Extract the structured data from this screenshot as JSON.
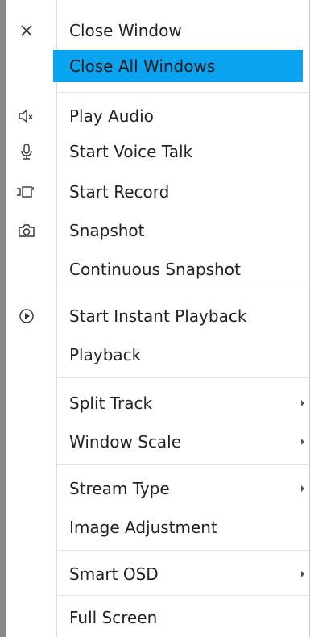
{
  "menu": {
    "items": [
      {
        "label": "Close Window",
        "icon": "close-icon",
        "submenu": false
      },
      {
        "label": "Close All Windows",
        "icon": null,
        "submenu": false,
        "highlighted": true
      },
      {
        "label": "Play Audio",
        "icon": "speaker-muted-icon",
        "submenu": false
      },
      {
        "label": "Start Voice Talk",
        "icon": "microphone-icon",
        "submenu": false
      },
      {
        "label": "Start Record",
        "icon": "record-icon",
        "submenu": false
      },
      {
        "label": "Snapshot",
        "icon": "camera-icon",
        "submenu": false
      },
      {
        "label": "Continuous Snapshot",
        "icon": null,
        "submenu": false
      },
      {
        "label": "Start Instant Playback",
        "icon": "play-circle-icon",
        "submenu": false
      },
      {
        "label": "Playback",
        "icon": null,
        "submenu": false
      },
      {
        "label": "Split Track",
        "icon": null,
        "submenu": true
      },
      {
        "label": "Window Scale",
        "icon": null,
        "submenu": true
      },
      {
        "label": "Stream Type",
        "icon": null,
        "submenu": true
      },
      {
        "label": "Image Adjustment",
        "icon": null,
        "submenu": false
      },
      {
        "label": "Smart OSD",
        "icon": null,
        "submenu": true
      },
      {
        "label": "Full Screen",
        "icon": null,
        "submenu": false
      }
    ]
  },
  "colors": {
    "highlight": "#0aa3ef",
    "text": "#222222",
    "border": "#8a8a8a"
  }
}
